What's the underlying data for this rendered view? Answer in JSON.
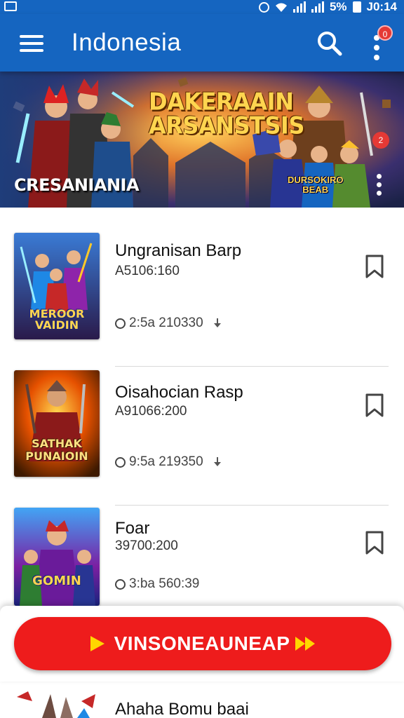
{
  "status_bar": {
    "battery_text": "5%",
    "time": "J0:14"
  },
  "app_bar": {
    "title": "Indonesia",
    "notification_count": "0"
  },
  "banner": {
    "title_line1": "DAKERAAIN",
    "title_line2": "ARSANSTSIS",
    "brand": "CRESANIANIA",
    "sub_logo_line1": "DURSOKIRO",
    "sub_logo_line2": "BEAB",
    "badge": "2"
  },
  "items": [
    {
      "title": "Ungranisan Barp",
      "subtitle": "A5106:160",
      "meta": "2:5a 210330"
    },
    {
      "title": "Oisahocian Rasp",
      "subtitle": "A91066:200",
      "meta": "9:5a 219350"
    },
    {
      "title": "Foar",
      "subtitle": "39700:200",
      "meta": "3:ba 560:39"
    }
  ],
  "thumb_labels": [
    "MEROOR VAIDIN",
    "SATHAK PUNAIOIN",
    "GOMIN"
  ],
  "cta": {
    "label": "VINSONEAUNEAP"
  },
  "partial_item": {
    "title": "Ahaha Bomu baai"
  },
  "colors": {
    "primary": "#1565c0",
    "cta": "#ee1c1c",
    "accent": "#ffd600",
    "badge": "#e53935"
  },
  "icons": [
    "menu-icon",
    "search-icon",
    "more-vert-icon",
    "bookmark-icon",
    "clock-icon",
    "download-icon",
    "play-icon",
    "fast-forward-icon"
  ]
}
